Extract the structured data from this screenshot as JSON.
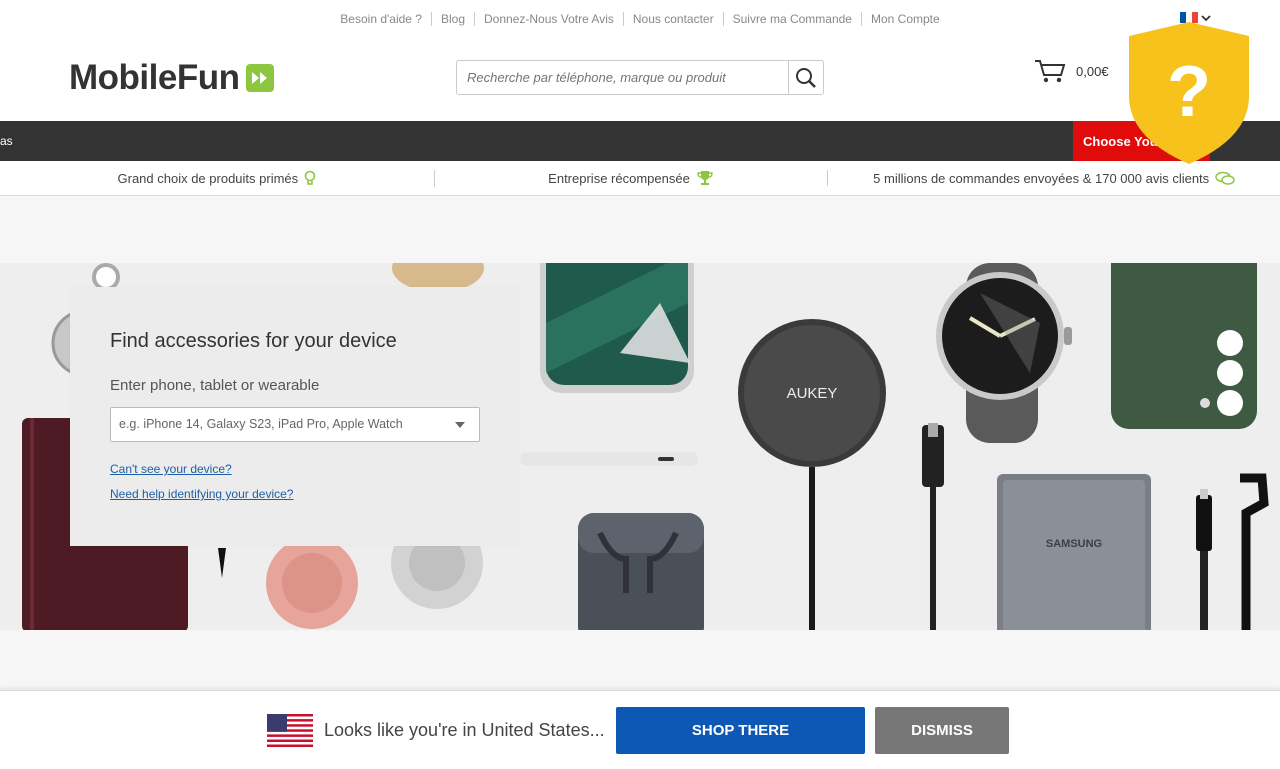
{
  "top_links": [
    "Besoin d'aide ?",
    "Blog",
    "Donnez-Nous Votre Avis",
    "Nous contacter",
    "Suivre ma Commande",
    "Mon Compte"
  ],
  "logo_text": "MobileFun",
  "search": {
    "placeholder": "Recherche par téléphone, marque ou produit"
  },
  "cart": {
    "total": "0,00€"
  },
  "nav": {
    "partial_label": "as",
    "choose_label": "Choose Your"
  },
  "usp": [
    {
      "text": "Grand choix de produits primés",
      "icon": "lightbulb-icon"
    },
    {
      "text": "Entreprise récompensée",
      "icon": "trophy-icon"
    },
    {
      "text": "5 millions de commandes envoyées & 170 000 avis clients",
      "icon": "chat-icon"
    }
  ],
  "hero": {
    "product_labels": {
      "aukey": "AUKEY",
      "samsung": "SAMSUNG"
    }
  },
  "finder": {
    "title": "Find accessories for your device",
    "label": "Enter phone, tablet or wearable",
    "select_placeholder": "e.g. iPhone 14, Galaxy S23, iPad Pro, Apple Watch",
    "link_cant_see": "Can't see your device?",
    "link_help": "Need help identifying your device?"
  },
  "overlay": {
    "icon": "question-shield-icon",
    "symbol": "?"
  },
  "geo_bar": {
    "text": "Looks like you're in United States...",
    "shop_label": "SHOP THERE",
    "dismiss_label": "DISMISS"
  },
  "colors": {
    "accent_green": "#8dc63f",
    "nav_dark": "#333333",
    "choose_red": "#e00b0b",
    "shop_blue": "#0d58b5",
    "dismiss_gray": "#777777",
    "shield_yellow": "#f6c21b",
    "link_blue": "#1e5fa8"
  }
}
